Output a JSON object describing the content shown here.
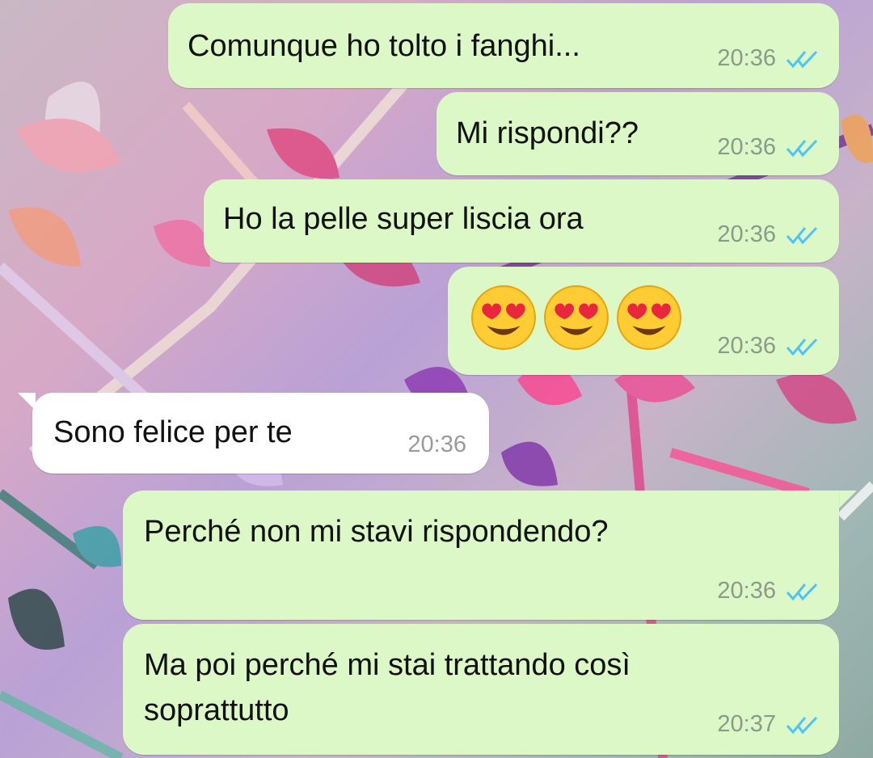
{
  "messages": [
    {
      "direction": "out",
      "text": "Comunque ho tolto i fanghi...",
      "time": "20:36",
      "status": "read-double-tick"
    },
    {
      "direction": "out",
      "text": "Mi rispondi??",
      "time": "20:36",
      "status": "read-double-tick"
    },
    {
      "direction": "out",
      "text": "Ho la pelle super liscia ora",
      "time": "20:36",
      "status": "read-double-tick"
    },
    {
      "direction": "out",
      "emoji": [
        "smiling-face-with-heart-eyes",
        "smiling-face-with-heart-eyes",
        "smiling-face-with-heart-eyes"
      ],
      "time": "20:36",
      "status": "read-double-tick"
    },
    {
      "direction": "in",
      "text": "Sono felice per te",
      "time": "20:36"
    },
    {
      "direction": "out",
      "text": "Perché non mi stavi rispondendo?",
      "time": "20:36",
      "status": "read-double-tick"
    },
    {
      "direction": "out",
      "text_lines": [
        "Ma poi perché mi stai trattando così",
        "soprattutto"
      ],
      "time": "20:37",
      "status": "read-double-tick"
    }
  ],
  "colors": {
    "outgoing_bubble": "#dcf8c6",
    "incoming_bubble": "#ffffff",
    "read_ticks": "#4fc3f7"
  }
}
